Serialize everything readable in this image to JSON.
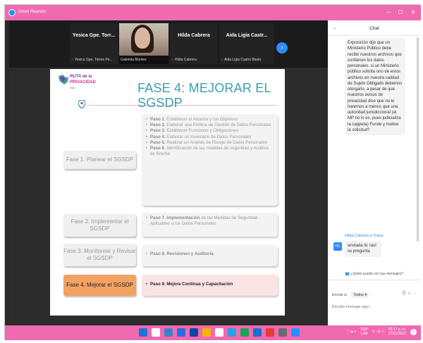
{
  "window": {
    "title": "Zoom Reunión",
    "minimize_glyph": "–",
    "maximize_glyph": "☐",
    "close_glyph": "✕"
  },
  "participants": [
    {
      "name": "Yesica Gpe. Torr...",
      "sub": "Yesica Gpe. Torres Pé..."
    },
    {
      "name": "",
      "sub": "Gabriela Montes",
      "has_video": true
    },
    {
      "name": "Hilda Cabrera",
      "sub": "Hilda Cabrera"
    },
    {
      "name": "Aida Ligia Castr...",
      "sub": "Aida Ligia Castro Basto"
    }
  ],
  "next_participants_glyph": "›",
  "slide": {
    "logo_line1": "RUTA de la",
    "logo_line2": "PRIVACIDAD",
    "logo_line3": "INAI",
    "title": "FASE 4: MEJORAR EL SGSDP",
    "phases": [
      {
        "label": "Fase 1. Planear el SGSDP",
        "active": false
      },
      {
        "label": "Fase 2. Implementar el SGSDP",
        "active": false
      },
      {
        "label": "Fase 3. Monitorear y Revisar el SGSDP",
        "active": false
      },
      {
        "label": "Fase 4. Mejorar el SGSDP",
        "active": true
      }
    ],
    "step_groups": [
      {
        "active": false,
        "steps": [
          {
            "bold": "Paso 1.",
            "text": " Establecer el Alcance y los Objetivos"
          },
          {
            "bold": "Paso 2.",
            "text": " Elaborar una Política de Gestión de Datos Personales"
          },
          {
            "bold": "Paso 3.",
            "text": " Establecer Funciones y Obligaciones"
          },
          {
            "bold": "Paso 4.",
            "text": " Elaborar un Inventario de Datos Personales"
          },
          {
            "bold": "Paso 5.",
            "text": " Realizar un Análisis de Riesgo de Datos Personales"
          },
          {
            "bold": "Paso 6.",
            "text": " Identificación de las medidas de seguridad y Análisis de Brecha"
          }
        ]
      },
      {
        "active": false,
        "steps": [
          {
            "bold": "Paso 7. Implementación",
            "text": " de las Medidas de Seguridad Aplicables a los Datos Personales"
          }
        ]
      },
      {
        "active": false,
        "steps": [
          {
            "bold": "Paso 8. Revisiones y Auditoría",
            "text": ""
          }
        ]
      },
      {
        "active": true,
        "steps": [
          {
            "bold": "Paso 9. Mejora Continua y Capacitación",
            "text": ""
          }
        ]
      }
    ]
  },
  "chat": {
    "title": "Chat",
    "collapse_glyph": "⌄",
    "message_1": "Exposición dijo que un Ministerio Público debe recibir nuestros archivos que contienen los datos personales. si un Ministerio público solicita uno de estos archivos en nuestra calidad de Sujeto Obligado debemos otorgarlo, a pesar de que nuestros avisos de privacidad dice que no lo haremos a menos que una autoridad jurisdiccional (el MP no lo es, pues judicializa la cappeta) Funde y motive la solicitud?",
    "sender_2": "Hilda Cabrera a Todos",
    "avatar_2": "HC",
    "message_2": "anotada lic raul su pregunta",
    "who_can_see": "¿Quién puede ver sus mensajes?",
    "send_to_label": "Enviar a:",
    "send_to_value": "Todos ▾",
    "tool_icons": "⎘ ☺ ···",
    "input_placeholder": "Escribir mensaje aquí..."
  },
  "taskbar": {
    "icon_colors": [
      "#1e73d8",
      "#ffffff",
      "#3b82c4",
      "#2d6cdf",
      "#0d47a1",
      "#f6b400",
      "#ffffff",
      "#2aa0e6",
      "#1ea05a",
      "#1d6fce",
      "#e23b3b",
      "#6c6c6c",
      "#2d8cff"
    ],
    "tray_glyphs": "^ ☁ ◐",
    "language": "ESP",
    "language_sub": "LAA",
    "tray_glyphs_2": "≋ ◁) ▭",
    "time": "02:17 p. m.",
    "date": "27/01/2022",
    "notif_count": "5"
  }
}
